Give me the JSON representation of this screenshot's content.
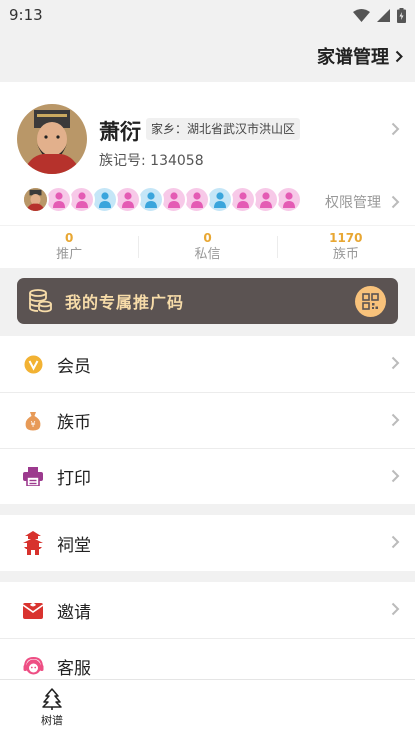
{
  "status_bar": {
    "time": "9:13"
  },
  "header": {
    "link_label": "家谱管理"
  },
  "profile": {
    "name": "萧衍",
    "hometown": "家乡：湖北省武汉市洪山区",
    "clan_id": "族记号: 134058",
    "permission_label": "权限管理",
    "member_avatars": [
      "portrait",
      "pink",
      "pink",
      "blue",
      "pink",
      "blue",
      "pink",
      "pink",
      "blue",
      "pink",
      "pink",
      "pink"
    ]
  },
  "stats": [
    {
      "value": "0",
      "label": "推广"
    },
    {
      "value": "0",
      "label": "私信"
    },
    {
      "value": "1170",
      "label": "族币"
    }
  ],
  "promo": {
    "label": "我的专属推广码"
  },
  "menu_group1": [
    {
      "label": "会员",
      "icon": "vip-icon"
    },
    {
      "label": "族币",
      "icon": "money-bag-icon"
    },
    {
      "label": "打印",
      "icon": "printer-icon"
    }
  ],
  "menu_group2": [
    {
      "label": "祠堂",
      "icon": "pagoda-icon"
    }
  ],
  "menu_group3": [
    {
      "label": "邀请",
      "icon": "envelope-icon"
    },
    {
      "label": "客服",
      "icon": "headset-icon"
    }
  ],
  "bottom_nav": {
    "tree_label": "树谱"
  },
  "colors": {
    "accent": "#e8a733",
    "promo_bg": "#5b5352",
    "promo_text": "#f7dca9"
  }
}
